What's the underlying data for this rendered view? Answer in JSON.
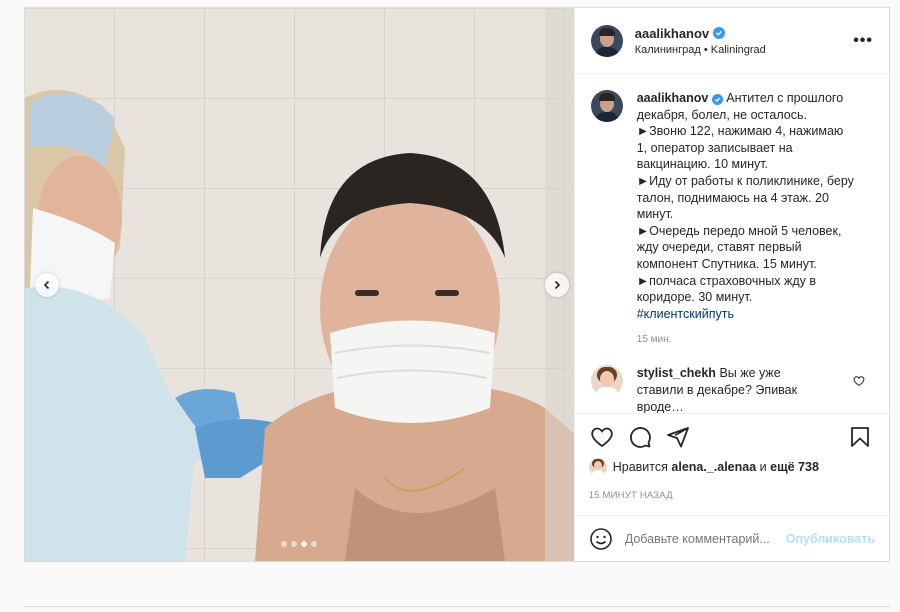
{
  "post": {
    "username": "aaalikhanov",
    "location": "Калининград • Kaliningrad",
    "more_label": "•••",
    "caption_lines": [
      "Антител с прошлого декабря, болел, не осталось.",
      "►Звоню 122, нажимаю 4, нажимаю 1, оператор записывает на вакцинацию. 10 минут.",
      "►Иду от работы к поликлинике, беру талон, поднимаюсь на 4 этаж. 20 минут.",
      "►Очередь передо мной 5 человек, жду очереди, ставят первый компонент Спутника. 15 минут.",
      "►полчаса страховочных жду в коридоре. 30 минут."
    ],
    "hashtag": "#клиентскийпуть",
    "caption_time": "15 мин.",
    "carousel": {
      "slides": 4,
      "active_index": 2
    }
  },
  "comment": {
    "username": "stylist_chekh",
    "text": "Вы же уже ставили в декабре? Эпивак вроде…"
  },
  "likes": {
    "prefix": "Нравится",
    "user": "alena._.alenaa",
    "middle": "и",
    "rest": "ещё 738"
  },
  "posted_ago": "15 МИНУТ НАЗАД",
  "add_comment": {
    "placeholder": "Добавьте комментарий...",
    "publish_label": "Опубликовать"
  },
  "colors": {
    "verified": "#3897f0",
    "link": "#00376b",
    "publish_disabled": "#b2dffc",
    "muted": "#8e8e8e"
  },
  "icons": [
    "chevron-left-icon",
    "chevron-right-icon",
    "verified-icon",
    "more-icon",
    "heart-icon",
    "comment-icon",
    "share-icon",
    "bookmark-icon",
    "emoji-icon"
  ]
}
